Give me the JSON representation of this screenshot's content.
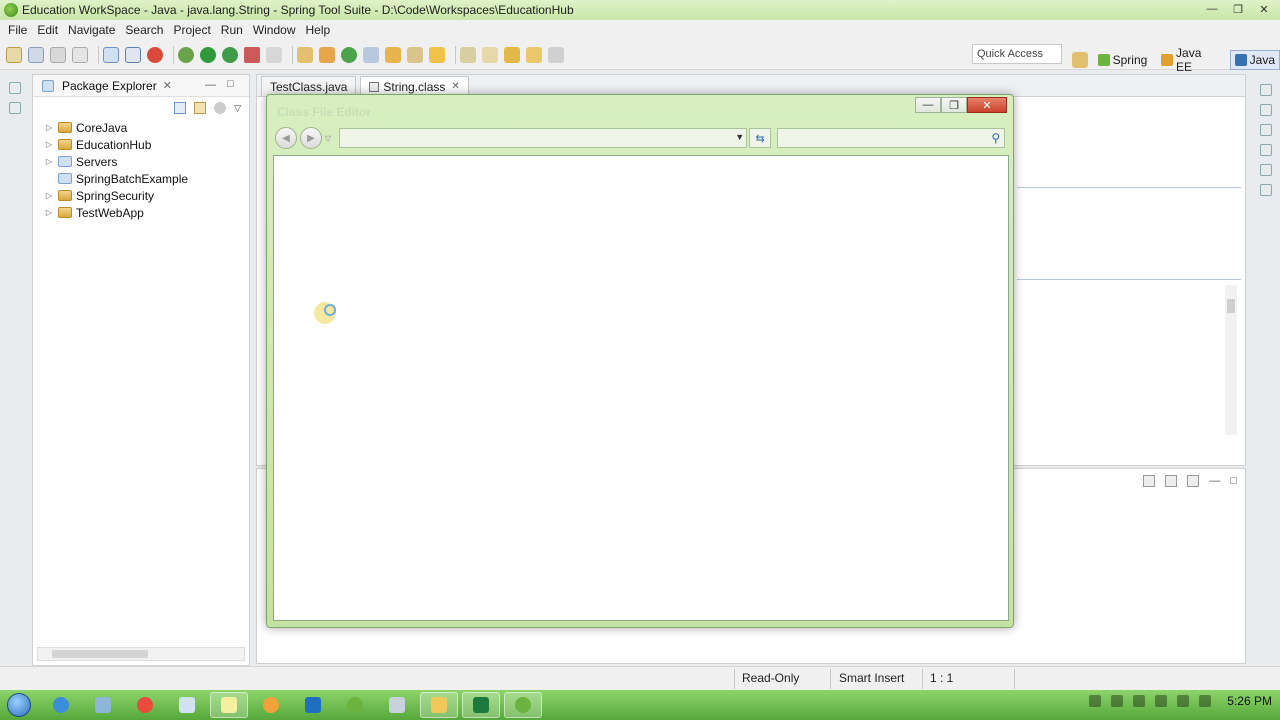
{
  "window": {
    "title": "Education WorkSpace - Java - java.lang.String - Spring Tool Suite - D:\\Code\\Workspaces\\EducationHub",
    "controls": [
      "—",
      "❐",
      "✕"
    ]
  },
  "menu": [
    "File",
    "Edit",
    "Navigate",
    "Search",
    "Project",
    "Run",
    "Window",
    "Help"
  ],
  "toolbar": {
    "quick_access": "Quick Access",
    "perspectives": [
      {
        "label": "Spring",
        "color": "#6db33f"
      },
      {
        "label": "Java EE",
        "color": "#e0a030"
      },
      {
        "label": "Java",
        "color": "#3a6fb0"
      }
    ]
  },
  "package_explorer": {
    "title": "Package Explorer",
    "close": "✕",
    "items": [
      {
        "label": "CoreJava",
        "arrow": "▷"
      },
      {
        "label": "EducationHub",
        "arrow": "▷"
      },
      {
        "label": "Servers",
        "arrow": "▷"
      },
      {
        "label": "SpringBatchExample",
        "arrow": ""
      },
      {
        "label": "SpringSecurity",
        "arrow": "▷"
      },
      {
        "label": "TestWebApp",
        "arrow": "▷"
      }
    ]
  },
  "editor": {
    "tabs": [
      {
        "label": "TestClass.java",
        "close": ""
      },
      {
        "label": "String.class",
        "close": "✕"
      }
    ]
  },
  "dialog": {
    "title": "Class File Editor",
    "controls": [
      "—",
      "❐",
      "✕"
    ],
    "address": "",
    "search_placeholder": ""
  },
  "status": {
    "read_only": "Read-Only",
    "insert_mode": "Smart Insert",
    "position": "1 : 1"
  },
  "taskbar": {
    "clock": "5:26 PM"
  }
}
